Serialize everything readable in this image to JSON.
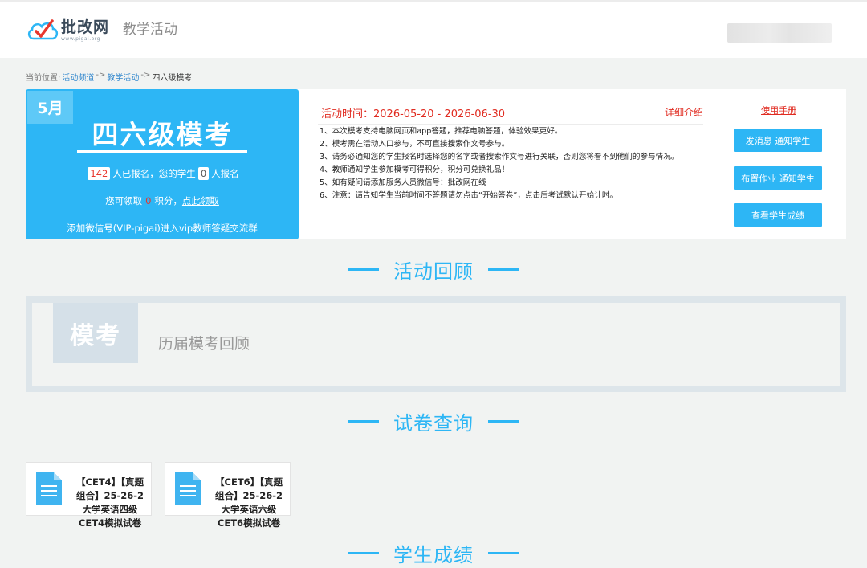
{
  "header": {
    "logo_main": "批改网",
    "logo_sub": "www.pigai.org",
    "section": "教学活动"
  },
  "breadcrumb": {
    "prefix": "当前位置:",
    "items": [
      "活动频道",
      "教学活动",
      "四六级模考"
    ],
    "separator": "->"
  },
  "activity": {
    "month": "5月",
    "title": "四六级模考",
    "signup": {
      "count": "142",
      "text_after_count": "人已报名，您的学生",
      "student_count": "0",
      "text_after_students": "人报名"
    },
    "points": {
      "prefix": "您可领取",
      "value": "0",
      "suffix": "积分，",
      "claim_link": "点此领取"
    },
    "wechat_note": "添加微信号(VIP-pigai)进入vip教师答疑交流群",
    "period": "活动时间：2026-05-20 - 2026-06-30",
    "detail_link": "详细介绍",
    "notes": [
      "1、本次模考支持电脑网页和app答题，推荐电脑答题，体验效果更好。",
      "2、模考需在活动入口参与，不可直接搜索作文号参与。",
      "3、请务必通知您的学生报名时选择您的名字或者搜索作文号进行关联，否则您将看不到他们的参与情况。",
      "4、教师通知学生参加模考可得积分，积分可兑换礼品！",
      "5、如有疑问请添加服务人员微信号：批改网在线",
      "6、注意：请告知学生当前时间不答题请勿点击“开始答卷”，点击后考试默认开始计时。"
    ],
    "manual_link": "使用手册",
    "buttons": [
      "发消息 通知学生",
      "布置作业 通知学生",
      "查看学生成绩"
    ]
  },
  "sections": {
    "review": "活动回顾",
    "papers": "试卷查询",
    "scores": "学生成绩"
  },
  "review": {
    "tag": "模考",
    "link": "历届模考回顾"
  },
  "papers": [
    {
      "title": "【CET4】【真题组合】25-26-2大学英语四级CET4模拟试卷"
    },
    {
      "title": "【CET6】【真题组合】25-26-2大学英语六级CET6模拟试卷"
    }
  ],
  "colors": {
    "accent": "#2db6f5",
    "danger": "#e02b20",
    "background": "#f1f3f2"
  }
}
